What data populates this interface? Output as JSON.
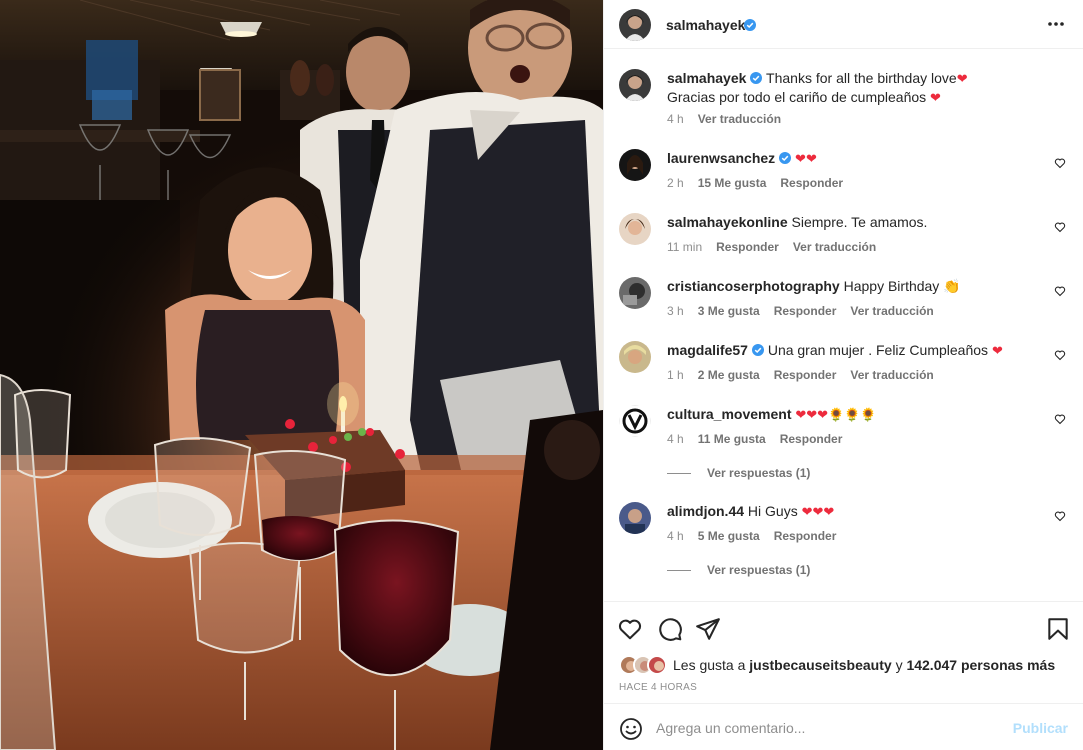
{
  "post": {
    "author": "salmahayek",
    "verified": true
  },
  "caption": {
    "username": "salmahayek",
    "line1": "Thanks for all the birthday love",
    "line2": "Gracias por todo el cariño de cumpleaños",
    "time": "4 h",
    "translate": "Ver traducción"
  },
  "comments": [
    {
      "username": "laurenwsanchez",
      "verified": true,
      "text": "",
      "emoji": "❤❤",
      "time": "2 h",
      "likes": "15 Me gusta",
      "reply": "Responder",
      "translate": ""
    },
    {
      "username": "salmahayekonline",
      "verified": false,
      "text": "Siempre. Te amamos.",
      "emoji": "",
      "time": "11 min",
      "likes": "",
      "reply": "Responder",
      "translate": "Ver traducción"
    },
    {
      "username": "cristiancoserphotography",
      "verified": false,
      "text": "Happy Birthday",
      "emoji": "👏",
      "time": "3 h",
      "likes": "3 Me gusta",
      "reply": "Responder",
      "translate": "Ver traducción"
    },
    {
      "username": "magdalife57",
      "verified": true,
      "text": "Una gran mujer . Feliz Cumpleaños",
      "emoji": "❤",
      "time": "1 h",
      "likes": "2 Me gusta",
      "reply": "Responder",
      "translate": "Ver traducción"
    },
    {
      "username": "cultura_movement",
      "verified": false,
      "text": "",
      "emoji": "❤❤❤🌻🌻🌻",
      "time": "4 h",
      "likes": "11 Me gusta",
      "reply": "Responder",
      "translate": "",
      "replies": "Ver respuestas (1)"
    },
    {
      "username": "alimdjon.44",
      "verified": false,
      "text": "Hi Guys",
      "emoji": "❤❤❤",
      "time": "4 h",
      "likes": "5 Me gusta",
      "reply": "Responder",
      "translate": "",
      "replies": "Ver respuestas (1)"
    }
  ],
  "likes": {
    "prefix": "Les gusta a",
    "first_user": "justbecauseitsbeauty",
    "connector": "y",
    "count": "142.047 personas más"
  },
  "timeago": "HACE 4 HORAS",
  "add_comment": {
    "placeholder": "Agrega un comentario...",
    "publish": "Publicar"
  },
  "icons": {
    "more": "more-horizontal-icon",
    "like": "heart-icon",
    "comment": "comment-icon",
    "share": "paper-plane-icon",
    "save": "bookmark-icon",
    "emoji": "smiley-icon",
    "verified": "verified-badge-icon"
  },
  "colors": {
    "heart": "#ed2b3d",
    "verified": "#3897f0",
    "publish": "#b2dffc",
    "meta": "#8e8e8e"
  }
}
